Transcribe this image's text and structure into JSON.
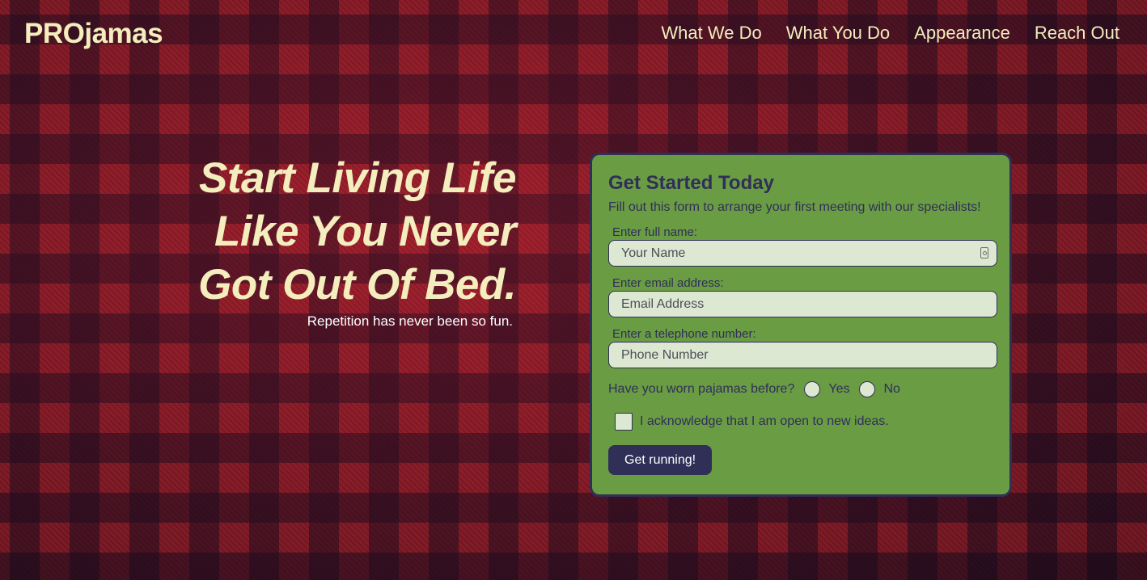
{
  "header": {
    "brand": "PROjamas",
    "nav": [
      {
        "label": "What We Do"
      },
      {
        "label": "What You Do"
      },
      {
        "label": "Appearance"
      },
      {
        "label": "Reach Out"
      }
    ]
  },
  "hero": {
    "lines": [
      "Start Living Life",
      "Like You Never",
      "Got Out Of Bed."
    ],
    "subtitle": "Repetition has never been so fun."
  },
  "form": {
    "title": "Get Started Today",
    "description": "Fill out this form to arrange your first meeting with our specialists!",
    "fields": [
      {
        "label": "Enter full name:",
        "placeholder": "Your Name"
      },
      {
        "label": "Enter email address:",
        "placeholder": "Email Address"
      },
      {
        "label": "Enter a telephone number:",
        "placeholder": "Phone Number"
      }
    ],
    "question": "Have you worn pajamas before?",
    "options": [
      "Yes",
      "No"
    ],
    "checkbox_label": "I acknowledge that I am open to new ideas.",
    "submit_label": "Get running!"
  },
  "colors": {
    "accent_cream": "#f4edbd",
    "form_green": "#6a9c44",
    "navy": "#2f2f58",
    "input_bg": "#dde8d3",
    "plaid_red": "#8e1f2a"
  },
  "icons": {
    "name_field_icon": "contact-card-icon"
  }
}
